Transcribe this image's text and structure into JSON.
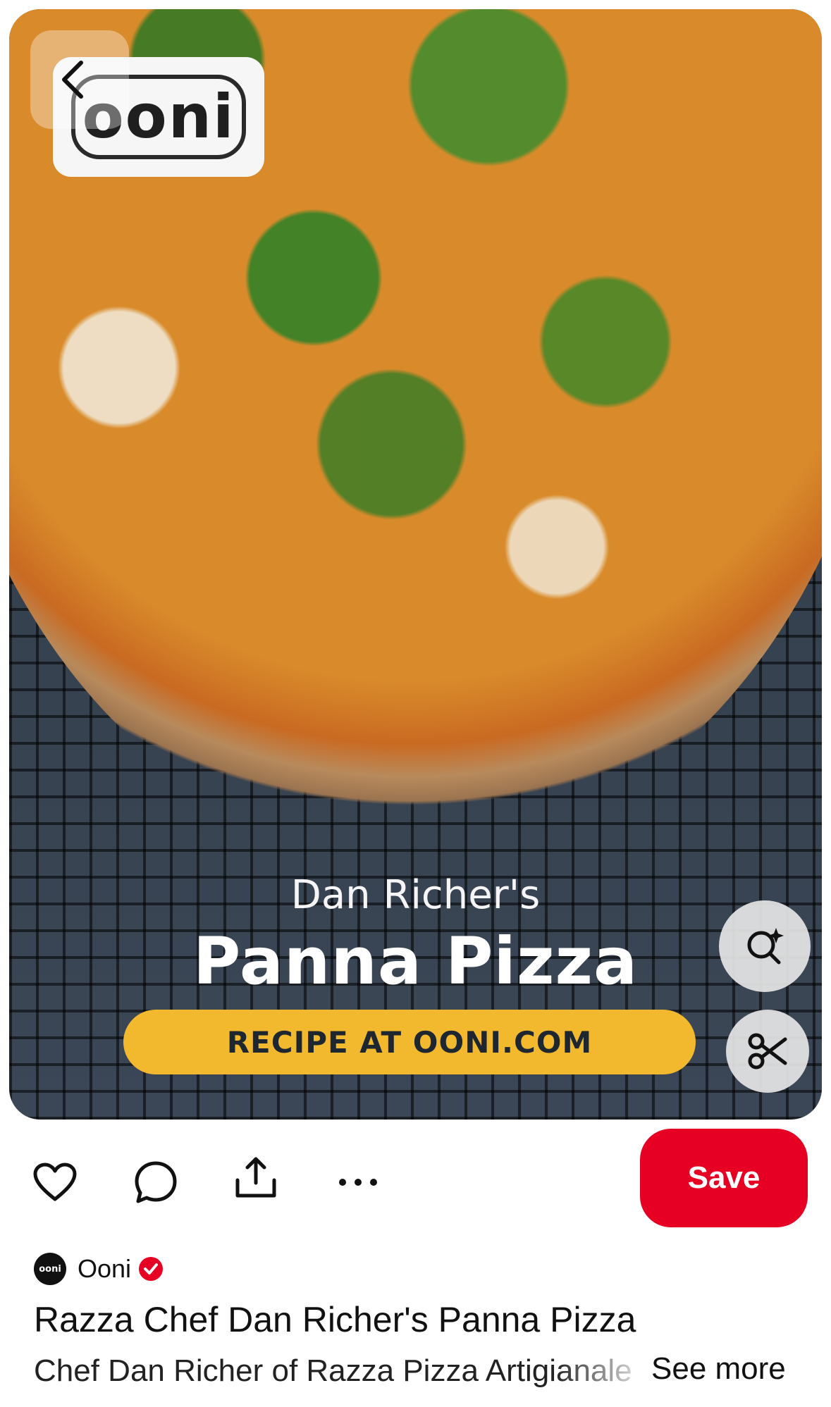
{
  "pin": {
    "brand_logo_text": "ooni",
    "overlay_subtitle": "Dan Richer's",
    "overlay_title": "Panna Pizza",
    "banner_text": "RECIPE AT OONI.COM"
  },
  "actions": {
    "save_label": "Save"
  },
  "author": {
    "avatar_text": "ooni",
    "name": "Ooni",
    "verified": true
  },
  "details": {
    "title": "Razza Chef Dan Richer's Panna Pizza",
    "description": "Chef Dan Richer of Razza Pizza Artigianale",
    "see_more_label": "See more"
  },
  "icons": {
    "back": "chevron-left-icon",
    "visual_search": "visual-search-icon",
    "cutout": "scissors-icon",
    "like": "heart-icon",
    "comment": "comment-icon",
    "share": "share-icon",
    "more": "more-icon",
    "verified": "verified-icon"
  },
  "colors": {
    "save_button": "#e60023",
    "banner": "#f3b92e",
    "verified": "#e60023"
  }
}
